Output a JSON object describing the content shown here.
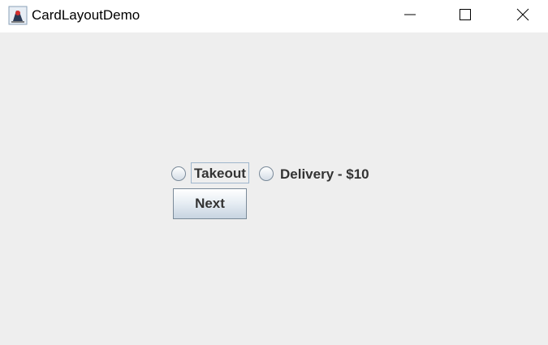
{
  "window": {
    "title": "CardLayoutDemo",
    "app_icon": "java-duke-icon",
    "controls": [
      "minimize-icon",
      "maximize-icon",
      "close-icon"
    ]
  },
  "card": {
    "options": [
      {
        "label": "Takeout",
        "selected": false,
        "focused": true
      },
      {
        "label": "Delivery - $10",
        "selected": false,
        "focused": false
      }
    ],
    "next_label": "Next"
  }
}
